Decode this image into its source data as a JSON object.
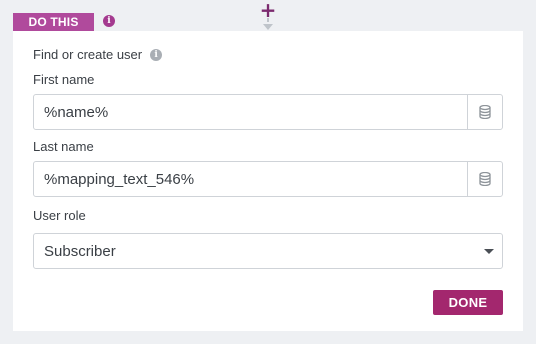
{
  "add_step": {
    "icon": "plus-icon",
    "accent": "#7b2a6e"
  },
  "tab": {
    "label": "DO THIS",
    "color": "#b04a9c",
    "info_icon": "info-icon"
  },
  "section": {
    "title": "Find or create user",
    "help_icon": "info-icon"
  },
  "fields": {
    "first_name": {
      "label": "First name",
      "value": "%name%",
      "side_icon": "database-icon"
    },
    "last_name": {
      "label": "Last name",
      "value": "%mapping_text_546%",
      "side_icon": "database-icon"
    },
    "user_role": {
      "label": "User role",
      "selected": "Subscriber",
      "icon": "chevron-down-icon"
    }
  },
  "actions": {
    "done_label": "DONE",
    "done_color": "#a3276e"
  }
}
